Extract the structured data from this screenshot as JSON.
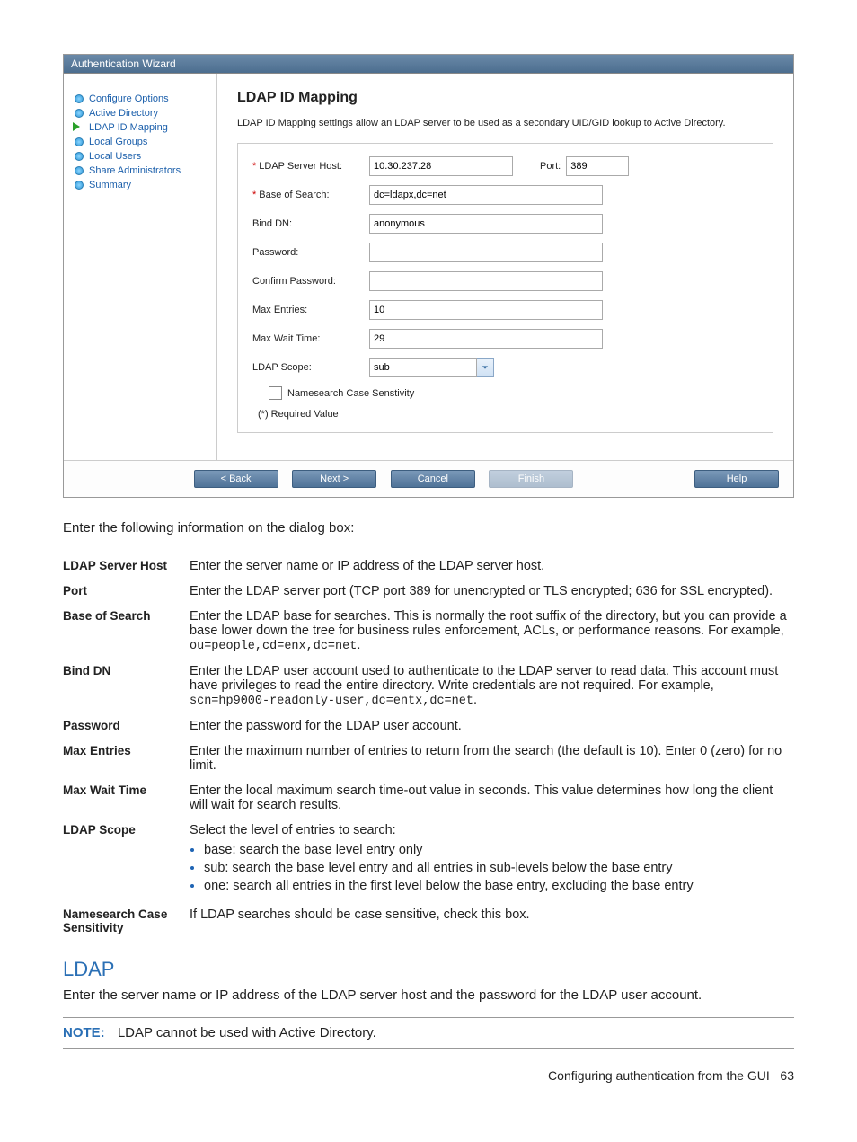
{
  "wizard": {
    "title": "Authentication Wizard",
    "nav": [
      {
        "label": "Configure Options",
        "active": false
      },
      {
        "label": "Active Directory",
        "active": false
      },
      {
        "label": "LDAP ID Mapping",
        "active": true
      },
      {
        "label": "Local Groups",
        "active": false
      },
      {
        "label": "Local Users",
        "active": false
      },
      {
        "label": "Share Administrators",
        "active": false
      },
      {
        "label": "Summary",
        "active": false
      }
    ],
    "heading": "LDAP ID Mapping",
    "description": "LDAP ID Mapping settings allow an LDAP server to be used as a secondary UID/GID lookup to Active Directory.",
    "fields": {
      "server_host_label": "LDAP Server Host:",
      "server_host_value": "10.30.237.28",
      "port_label": "Port:",
      "port_value": "389",
      "base_label": "Base of Search:",
      "base_value": "dc=ldapx,dc=net",
      "bind_label": "Bind DN:",
      "bind_value": "anonymous",
      "pw_label": "Password:",
      "pw_value": "",
      "cpw_label": "Confirm Password:",
      "cpw_value": "",
      "max_entries_label": "Max Entries:",
      "max_entries_value": "10",
      "max_wait_label": "Max Wait Time:",
      "max_wait_value": "29",
      "scope_label": "LDAP Scope:",
      "scope_value": "sub",
      "case_label": "Namesearch Case Senstivity",
      "required_note": "(*) Required Value"
    },
    "buttons": {
      "back": "< Back",
      "next": "Next >",
      "cancel": "Cancel",
      "finish": "Finish",
      "help": "Help"
    }
  },
  "intro": "Enter the following information on the dialog box:",
  "definitions": [
    {
      "term": "LDAP Server Host",
      "desc": "Enter the server name or IP address of the LDAP server host."
    },
    {
      "term": "Port",
      "desc": "Enter the LDAP server port (TCP port 389 for unencrypted or TLS encrypted; 636 for SSL encrypted)."
    },
    {
      "term": "Base of Search",
      "desc": "Enter the LDAP base for searches. This is normally the root suffix of the directory, but you can provide a base lower down the tree for business rules enforcement, ACLs, or performance reasons. For example, ",
      "code": "ou=people,cd=enx,dc=net",
      "suffix": "."
    },
    {
      "term": "Bind DN",
      "desc": "Enter the LDAP user account used to authenticate to the LDAP server to read data. This account must have privileges to read the entire directory. Write credentials are not required. For example, ",
      "code": "scn=hp9000-readonly-user,dc=entx,dc=net",
      "suffix": "."
    },
    {
      "term": "Password",
      "desc": "Enter the password for the LDAP user account."
    },
    {
      "term": "Max Entries",
      "desc": "Enter the maximum number of entries to return from the search (the default is 10). Enter 0 (zero) for no limit."
    },
    {
      "term": "Max Wait Time",
      "desc": "Enter the local maximum search time-out value in seconds. This value determines how long the client will wait for search results."
    },
    {
      "term": "LDAP Scope",
      "desc": "Select the level of entries to search:",
      "list": [
        "base: search the base level entry only",
        "sub: search the base level entry and all entries in sub-levels below the base entry",
        "one: search all entries in the first level below the base entry, excluding the base entry"
      ]
    },
    {
      "term": "Namesearch Case Sensitivity",
      "desc": "If LDAP searches should be case sensitive, check this box."
    }
  ],
  "section": {
    "title": "LDAP",
    "body": "Enter the server name or IP address of the LDAP server host and the password for the LDAP user account.",
    "note_label": "NOTE:",
    "note_body": "LDAP cannot be used with Active Directory."
  },
  "footer": {
    "text": "Configuring authentication from the GUI",
    "page": "63"
  }
}
